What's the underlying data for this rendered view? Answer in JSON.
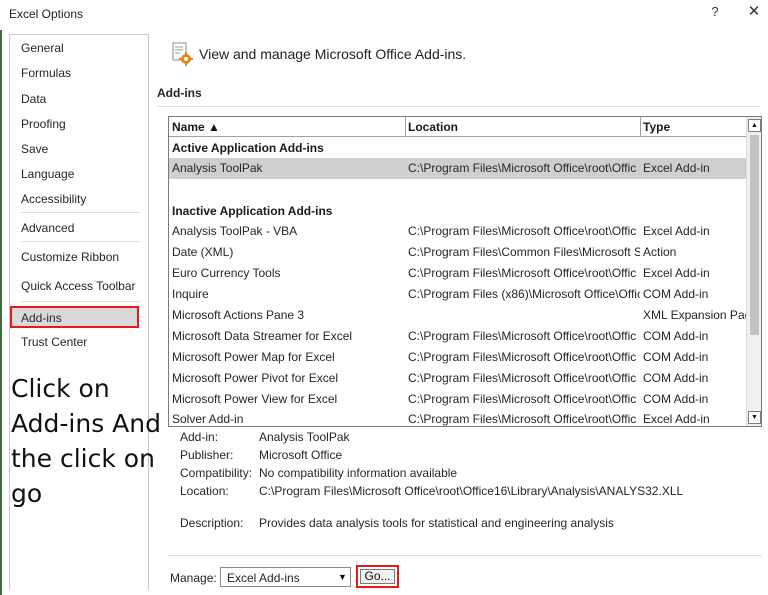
{
  "window": {
    "title": "Excel Options",
    "help_glyph": "?",
    "close_glyph": "✕"
  },
  "sidebar": {
    "items": [
      {
        "label": "General"
      },
      {
        "label": "Formulas"
      },
      {
        "label": "Data"
      },
      {
        "label": "Proofing"
      },
      {
        "label": "Save"
      },
      {
        "label": "Language"
      },
      {
        "label": "Accessibility"
      },
      {
        "label": "Advanced"
      },
      {
        "label": "Customize Ribbon"
      },
      {
        "label": "Quick Access Toolbar"
      },
      {
        "label": "Add-ins"
      },
      {
        "label": "Trust Center"
      }
    ],
    "selected": "Add-ins"
  },
  "annotation": {
    "lines": [
      "Click on",
      "Add-ins And",
      "the click on",
      "go"
    ]
  },
  "main": {
    "header_text": "View and manage Microsoft Office Add-ins.",
    "section_label": "Add-ins",
    "table": {
      "columns": [
        "Name ▲",
        "Location",
        "Type"
      ],
      "active_group_label": "Active Application Add-ins",
      "active_rows": [
        {
          "name": "Analysis ToolPak",
          "location": "C:\\Program Files\\Microsoft Office\\root\\Offic",
          "type": "Excel Add-in"
        }
      ],
      "inactive_group_label": "Inactive Application Add-ins",
      "inactive_rows": [
        {
          "name": "Analysis ToolPak - VBA",
          "location": "C:\\Program Files\\Microsoft Office\\root\\Offic",
          "type": "Excel Add-in"
        },
        {
          "name": "Date (XML)",
          "location": "C:\\Program Files\\Common Files\\Microsoft S",
          "type": "Action"
        },
        {
          "name": "Euro Currency Tools",
          "location": "C:\\Program Files\\Microsoft Office\\root\\Offic",
          "type": "Excel Add-in"
        },
        {
          "name": "Inquire",
          "location": "C:\\Program Files (x86)\\Microsoft Office\\Offic",
          "type": "COM Add-in"
        },
        {
          "name": "Microsoft Actions Pane 3",
          "location": "",
          "type": "XML Expansion Pack"
        },
        {
          "name": "Microsoft Data Streamer for Excel",
          "location": "C:\\Program Files\\Microsoft Office\\root\\Offic",
          "type": "COM Add-in"
        },
        {
          "name": "Microsoft Power Map for Excel",
          "location": "C:\\Program Files\\Microsoft Office\\root\\Offic",
          "type": "COM Add-in"
        },
        {
          "name": "Microsoft Power Pivot for Excel",
          "location": "C:\\Program Files\\Microsoft Office\\root\\Offic",
          "type": "COM Add-in"
        },
        {
          "name": "Microsoft Power View for Excel",
          "location": "C:\\Program Files\\Microsoft Office\\root\\Offic",
          "type": "COM Add-in"
        },
        {
          "name": "Solver Add-in",
          "location": "C:\\Program Files\\Microsoft Office\\root\\Offic",
          "type": "Excel Add-in"
        }
      ]
    },
    "details": {
      "addin_label": "Add-in:",
      "addin_value": "Analysis ToolPak",
      "publisher_label": "Publisher:",
      "publisher_value": "Microsoft Office",
      "compat_label": "Compatibility:",
      "compat_value": "No compatibility information available",
      "location_label": "Location:",
      "location_value": "C:\\Program Files\\Microsoft Office\\root\\Office16\\Library\\Analysis\\ANALYS32.XLL",
      "description_label": "Description:",
      "description_value": "Provides data analysis tools for statistical and engineering analysis"
    },
    "manage": {
      "label": "Manage:",
      "value": "Excel Add-ins",
      "go_label": "Go..."
    }
  },
  "colors": {
    "highlight_border": "#e21b1b",
    "selected_row": "#cfcfcf",
    "selected_nav": "#d9d9d9"
  }
}
